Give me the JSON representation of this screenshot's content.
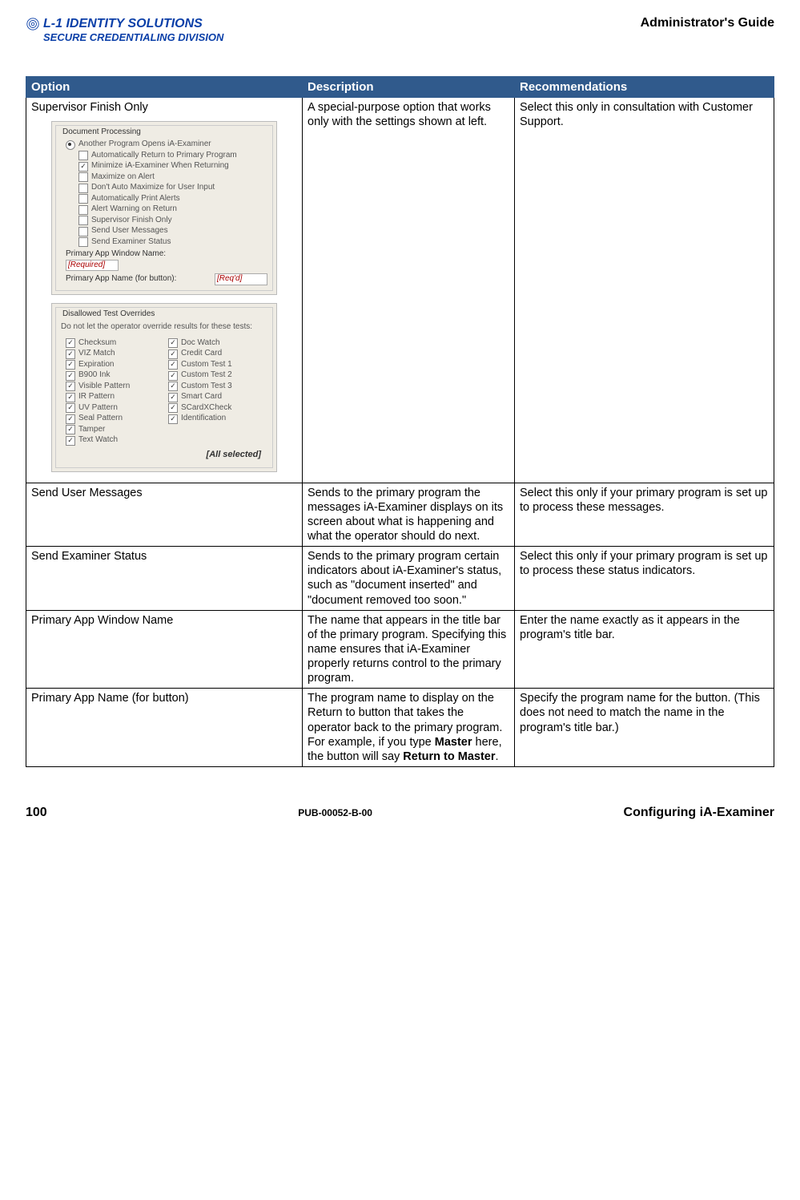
{
  "header": {
    "logo_line1": "L-1 IDENTITY SOLUTIONS",
    "logo_line2": "SECURE CREDENTIALING DIVISION",
    "guide_title": "Administrator's Guide"
  },
  "table": {
    "headers": {
      "option": "Option",
      "description": "Description",
      "recommendations": "Recommendations"
    },
    "rows": [
      {
        "option_title": "Supervisor Finish Only",
        "description": "A special-purpose option that works only with the settings shown at left.",
        "recommendation": "Select this only in consultation with Customer Support.",
        "has_screenshots": true
      },
      {
        "option_title": "Send User Messages",
        "description": "Sends to the primary program the messages iA-Examiner displays on its screen about what is happening and what the operator should do next.",
        "recommendation": "Select this only if your primary program is set up to process these messages."
      },
      {
        "option_title": "Send Examiner Status",
        "description": "Sends to the primary program certain indicators about iA-Examiner's status, such as \"document inserted\" and \"document removed too soon.\"",
        "recommendation": "Select this only if your primary program is set up to process these status indicators."
      },
      {
        "option_title": "Primary App Window Name",
        "description": "The name that appears in the title bar of the primary program. Specifying this name ensures that iA-Examiner properly returns control to the primary program.",
        "recommendation": "Enter the name exactly as it appears in the program's title bar."
      },
      {
        "option_title": "Primary App Name (for button)",
        "description_pre": "The program name to display on the Return to button that takes the operator back to the primary program. For example, if you type ",
        "description_bold1": "Master",
        "description_mid": " here, the button will say ",
        "description_bold2": "Return to Master",
        "description_post": ".",
        "recommendation": "Specify the program name for the button. (This does not need to match the name in the program's title bar.)"
      }
    ]
  },
  "screenshot1": {
    "group_label": "Document Processing",
    "radio_label": "Another Program Opens iA-Examiner",
    "checks": [
      {
        "label": "Automatically Return to Primary Program",
        "checked": false
      },
      {
        "label": "Minimize iA-Examiner When Returning",
        "checked": true
      },
      {
        "label": "Maximize on Alert",
        "checked": false
      },
      {
        "label": "Don't Auto Maximize for User Input",
        "checked": false
      },
      {
        "label": "Automatically Print Alerts",
        "checked": false
      },
      {
        "label": "Alert Warning on Return",
        "checked": false
      },
      {
        "label": "Supervisor Finish Only",
        "checked": false
      },
      {
        "label": "Send User Messages",
        "checked": false
      },
      {
        "label": "Send Examiner Status",
        "checked": false
      }
    ],
    "window_name_label": "Primary App Window Name:",
    "window_name_value": "[Required]",
    "button_name_label": "Primary App Name (for button):",
    "button_name_value": "[Req'd]"
  },
  "screenshot2": {
    "group_label": "Disallowed Test Overrides",
    "sub_label": "Do not let the operator override results for these tests:",
    "left": [
      "Checksum",
      "VIZ Match",
      "Expiration",
      "B900 Ink",
      "Visible Pattern",
      "IR Pattern",
      "UV Pattern",
      "Seal Pattern",
      "Tamper",
      "Text Watch"
    ],
    "right": [
      "Doc Watch",
      "Credit Card",
      "Custom Test 1",
      "Custom Test 2",
      "Custom Test 3",
      "Smart Card",
      "SCardXCheck",
      "Identification"
    ],
    "all_selected": "[All selected]"
  },
  "footer": {
    "page_number": "100",
    "pub_id": "PUB-00052-B-00",
    "section": "Configuring iA-Examiner"
  }
}
